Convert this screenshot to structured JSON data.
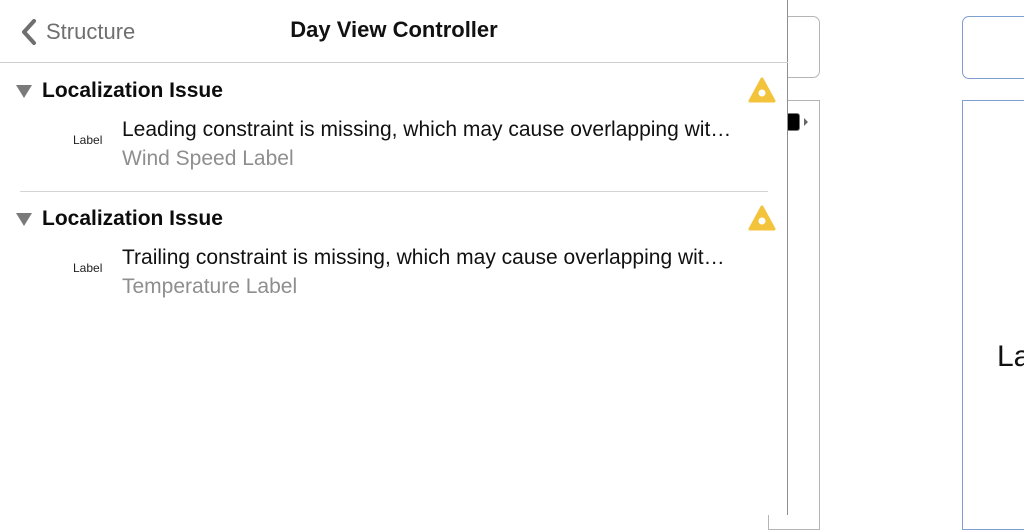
{
  "nav": {
    "back_label": "Structure",
    "title": "Day View Controller"
  },
  "issues": [
    {
      "category": "Localization Issue",
      "type_tag": "Label",
      "message": "Leading constraint is missing, which may cause overlapping with other views.",
      "subject": "Wind Speed Label"
    },
    {
      "category": "Localization Issue",
      "type_tag": "Label",
      "message": "Trailing constraint is missing, which may cause overlapping with other views.",
      "subject": "Temperature Label"
    }
  ],
  "canvas": {
    "partial_label": "La"
  },
  "colors": {
    "warning": "#f3c43b",
    "disclosure": "#7a7a7a",
    "secondary_text": "#8e8e8e",
    "canvas_selection": "#7f9fd0"
  }
}
